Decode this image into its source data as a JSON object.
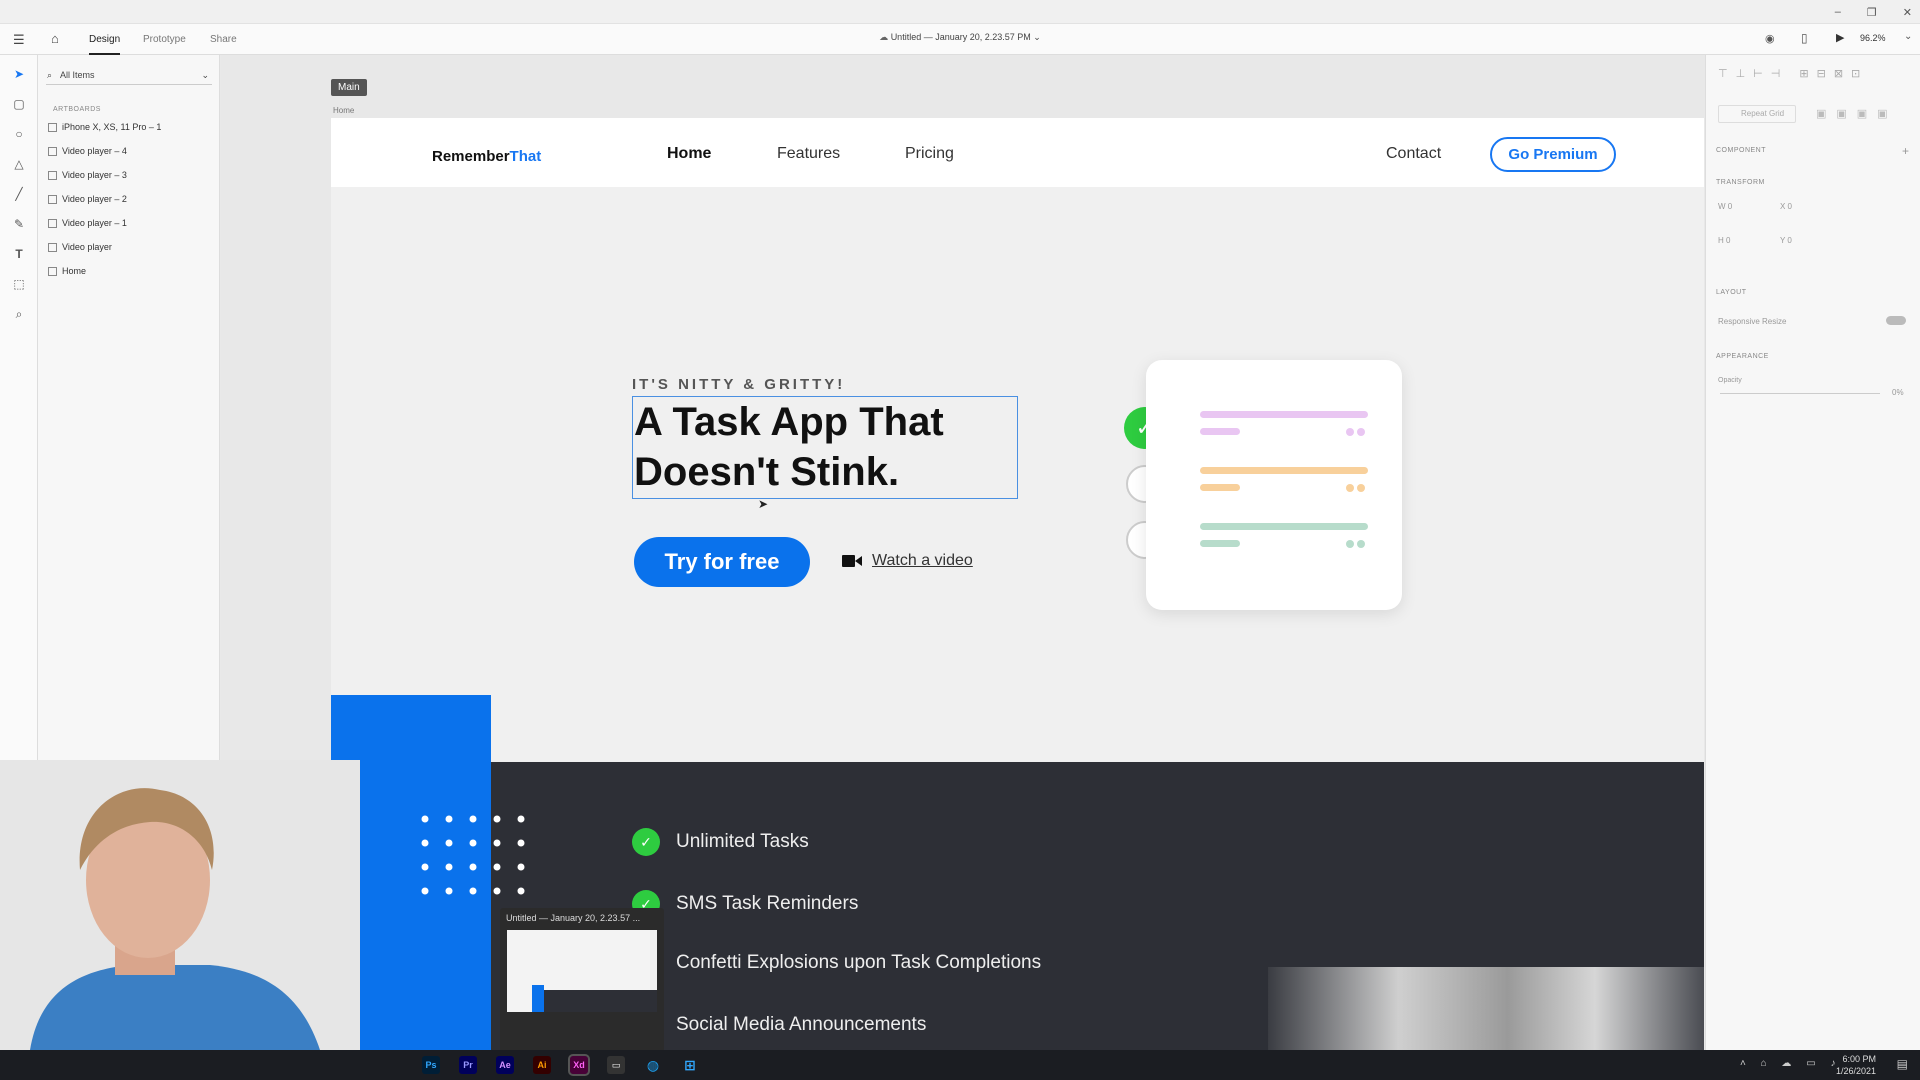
{
  "window": {
    "controls": [
      "–",
      "❐",
      "✕"
    ]
  },
  "appbar": {
    "tabs": [
      "Design",
      "Prototype",
      "Share"
    ],
    "doc_title": "Untitled — January 20, 2.23.57 PM",
    "zoom": "96.2%"
  },
  "layers": {
    "search_placeholder": "All Items",
    "section": "ARTBOARDS",
    "items": [
      "iPhone X, XS, 11 Pro – 1",
      "Video player – 4",
      "Video player – 3",
      "Video player – 2",
      "Video player – 1",
      "Video player",
      "Home"
    ]
  },
  "canvas": {
    "artboard_tag": "Main",
    "artboard_name": "Home"
  },
  "site": {
    "logo_main": "Remember",
    "logo_accent": "That",
    "nav": [
      "Home",
      "Features",
      "Pricing"
    ],
    "contact": "Contact",
    "premium": "Go Premium",
    "eyebrow": "IT'S NITTY & GRITTY!",
    "headline_line1": "A Task App That",
    "headline_line2": "Doesn't Stink.",
    "cta": "Try for free",
    "watch": "Watch a video",
    "features": [
      "Unlimited Tasks",
      "SMS Task Reminders",
      "Confetti Explosions upon Task Completions",
      "Social Media Announcements"
    ]
  },
  "rpanel": {
    "repeat_grid": "Repeat Grid",
    "component": "COMPONENT",
    "transform": "TRANSFORM",
    "w": "W 0",
    "x": "X 0",
    "h": "H 0",
    "y": "Y 0",
    "layout": "LAYOUT",
    "responsive": "Responsive Resize",
    "appearance": "APPEARANCE",
    "opacity": "Opacity",
    "opacity_val": "0%"
  },
  "thumbnail": {
    "title": "Untitled — January 20, 2.23.57 ..."
  },
  "taskbar": {
    "apps": [
      "Ps",
      "Pr",
      "Ae",
      "Ai",
      "Xd"
    ],
    "time": "6:00 PM",
    "date": "1/26/2021"
  },
  "colors": {
    "accent": "#0a72ec",
    "check": "#2ecc40",
    "dark": "#2d2f36"
  }
}
